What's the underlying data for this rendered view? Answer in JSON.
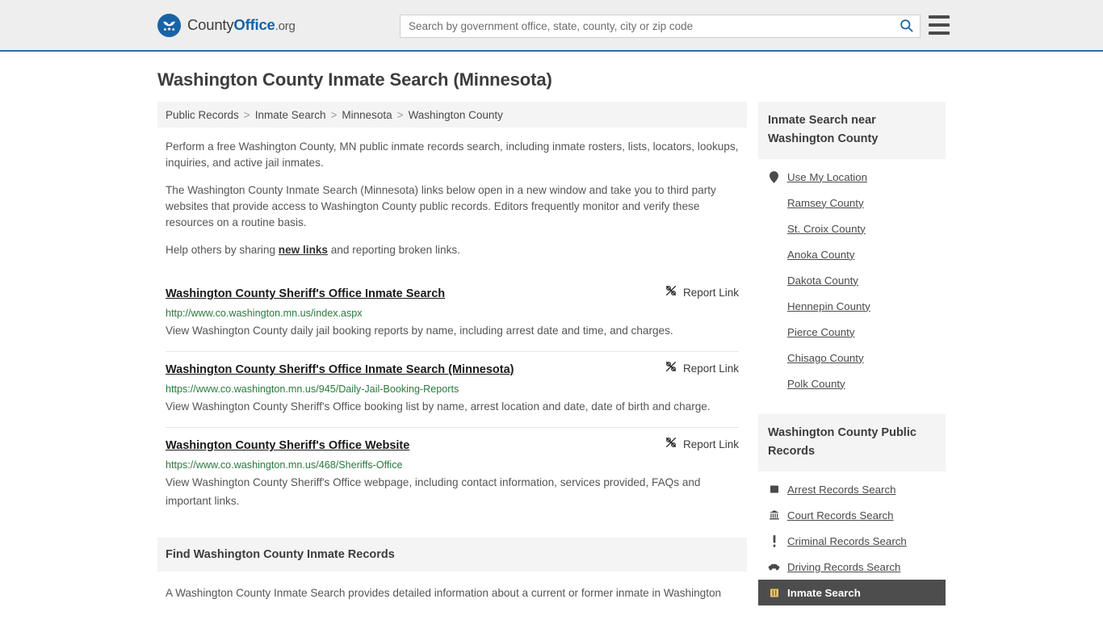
{
  "header": {
    "brand": {
      "county": "County",
      "office": "Office",
      "tld": ".org",
      "icon": "eagle-seal-icon"
    },
    "search": {
      "placeholder": "Search by government office, state, county, city or zip code",
      "value": "",
      "icon": "search-icon"
    },
    "menu": {
      "icon": "hamburger-menu-icon",
      "label": "Menu"
    }
  },
  "page": {
    "title": "Washington County Inmate Search (Minnesota)",
    "breadcrumb": [
      "Public Records",
      "Inmate Search",
      "Minnesota",
      "Washington County"
    ],
    "breadcrumb_separator": ">",
    "intro": {
      "p1": "Perform a free Washington County, MN public inmate records search, including inmate rosters, lists, locators, lookups, inquiries, and active jail inmates.",
      "p2": "The Washington County Inmate Search (Minnesota) links below open in a new window and take you to third party websites that provide access to Washington County public records. Editors frequently monitor and verify these resources on a routine basis.",
      "p3_before": "Help others by sharing ",
      "p3_link": "new links",
      "p3_after": " and reporting broken links."
    },
    "report_link_label": "Report Link",
    "report_link_icon": "broken-link-icon",
    "results": [
      {
        "title": "Washington County Sheriff's Office Inmate Search",
        "url": "http://www.co.washington.mn.us/index.aspx",
        "description": "View Washington County daily jail booking reports by name, including arrest date and time, and charges."
      },
      {
        "title": "Washington County Sheriff's Office Inmate Search (Minnesota)",
        "url": "https://www.co.washington.mn.us/945/Daily-Jail-Booking-Reports",
        "description": "View Washington County Sheriff's Office booking list by name, arrest location and date, date of birth and charge."
      },
      {
        "title": "Washington County Sheriff's Office Website",
        "url": "https://www.co.washington.mn.us/468/Sheriffs-Office",
        "description": "View Washington County Sheriff's Office webpage, including contact information, services provided, FAQs and important links."
      }
    ],
    "find_section": {
      "heading": "Find Washington County Inmate Records",
      "paragraph": "A Washington County Inmate Search provides detailed information about a current or former inmate in Washington"
    }
  },
  "sidebar": {
    "nearby": {
      "heading": "Inmate Search near Washington County",
      "items": [
        {
          "label": "Use My Location",
          "icon": "map-pin-icon"
        },
        {
          "label": "Ramsey County",
          "icon": ""
        },
        {
          "label": "St. Croix County",
          "icon": ""
        },
        {
          "label": "Anoka County",
          "icon": ""
        },
        {
          "label": "Dakota County",
          "icon": ""
        },
        {
          "label": "Hennepin County",
          "icon": ""
        },
        {
          "label": "Pierce County",
          "icon": ""
        },
        {
          "label": "Chisago County",
          "icon": ""
        },
        {
          "label": "Polk County",
          "icon": ""
        }
      ]
    },
    "public_records": {
      "heading": "Washington County Public Records",
      "items": [
        {
          "label": "Arrest Records Search",
          "icon": "fingerprint-card-icon",
          "active": false
        },
        {
          "label": "Court Records Search",
          "icon": "courthouse-icon",
          "active": false
        },
        {
          "label": "Criminal Records Search",
          "icon": "exclamation-icon",
          "active": false
        },
        {
          "label": "Driving Records Search",
          "icon": "car-icon",
          "active": false
        },
        {
          "label": "Inmate Search",
          "icon": "jail-door-icon",
          "active": true
        }
      ]
    }
  },
  "colors": {
    "brand_blue": "#1763a6",
    "header_bg": "#eeeeee",
    "header_border": "#2f6ca8",
    "panel_bg": "#f4f4f4",
    "url_green": "#2a7a3d",
    "active_bg": "#4d4d4d",
    "active_icon": "#e8c56a"
  }
}
